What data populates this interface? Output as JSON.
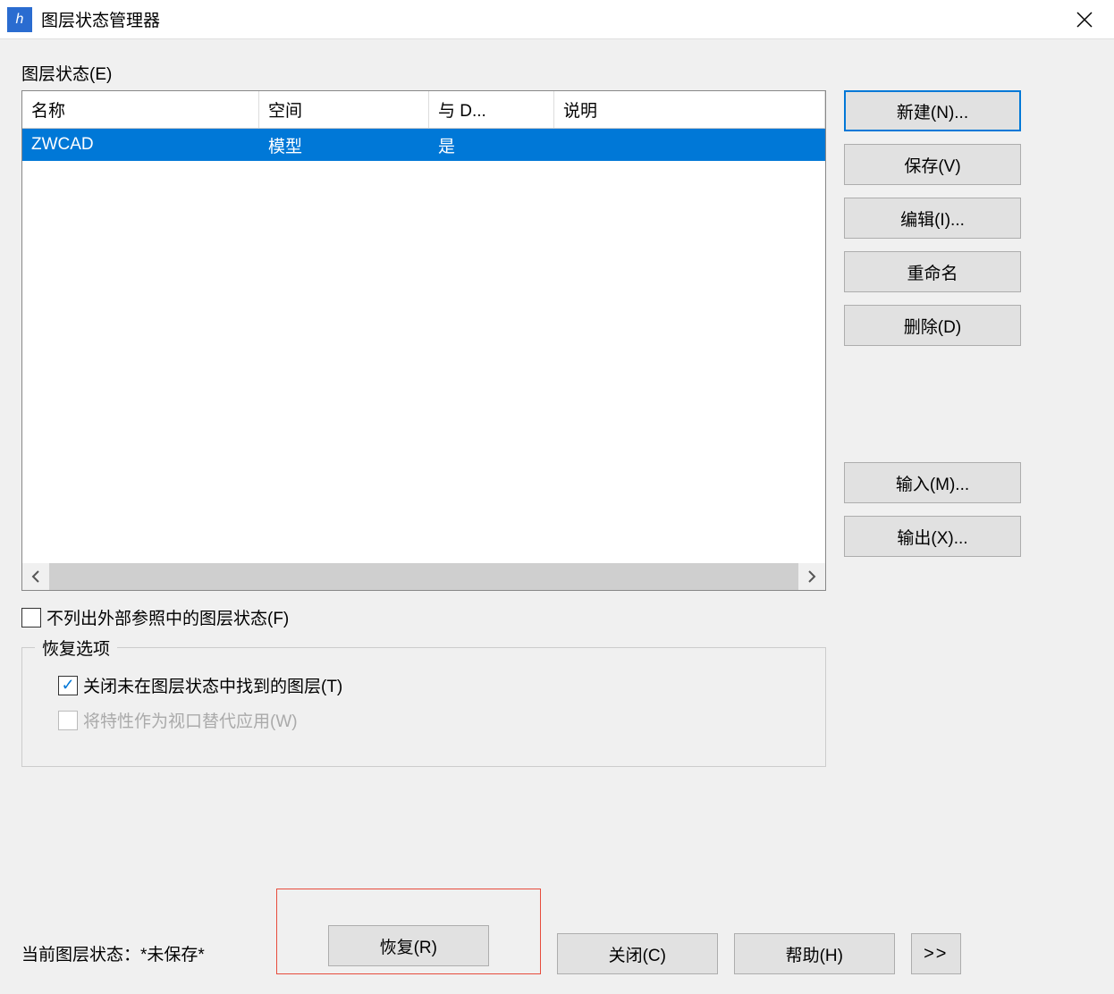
{
  "titlebar": {
    "title": "图层状态管理器",
    "icon_label": "h"
  },
  "section": {
    "layer_states_label": "图层状态(E)"
  },
  "table": {
    "headers": {
      "name": "名称",
      "space": "空间",
      "same_as_dwg": "与 D...",
      "description": "说明"
    },
    "rows": [
      {
        "name": "ZWCAD",
        "space": "模型",
        "same_as_dwg": "是",
        "description": ""
      }
    ]
  },
  "side_buttons": {
    "new": "新建(N)...",
    "save": "保存(V)",
    "edit": "编辑(I)...",
    "rename": "重命名",
    "delete": "删除(D)",
    "import": "输入(M)...",
    "export": "输出(X)..."
  },
  "checkboxes": {
    "hide_xref": "不列出外部参照中的图层状态(F)"
  },
  "restore_options": {
    "legend": "恢复选项",
    "turn_off_missing": "关闭未在图层状态中找到的图层(T)",
    "apply_as_viewport_overrides": "将特性作为视口替代应用(W)"
  },
  "footer": {
    "current_label": "当前图层状态：",
    "current_value": "*未保存*",
    "restore": "恢复(R)",
    "close": "关闭(C)",
    "help": "帮助(H)",
    "expand": ">>"
  }
}
